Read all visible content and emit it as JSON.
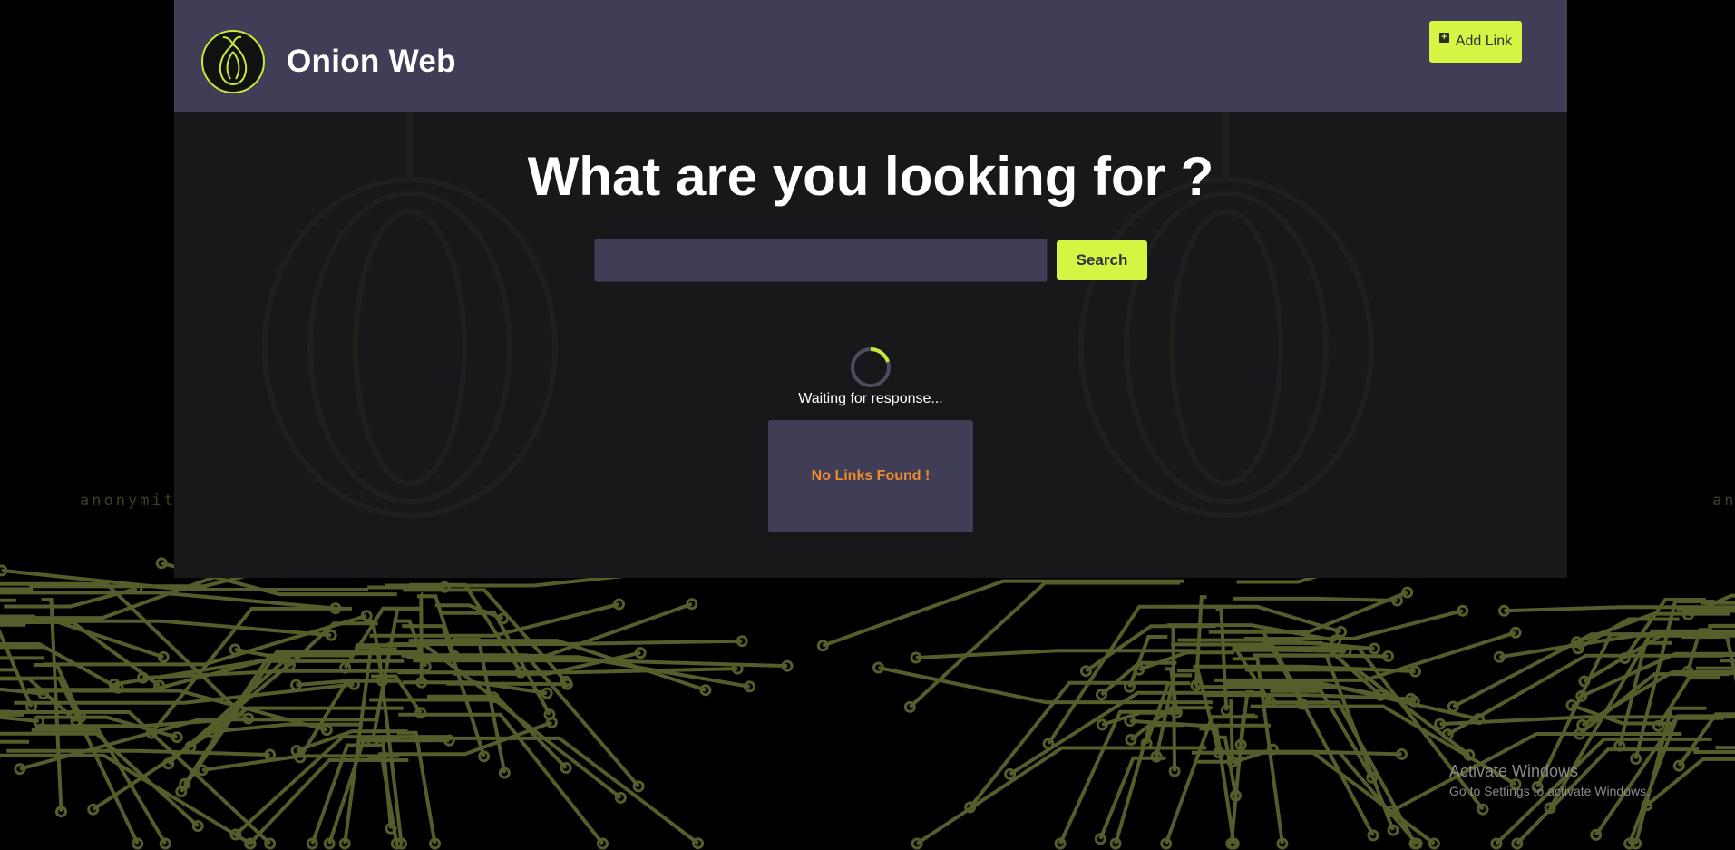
{
  "brand": {
    "name": "Onion Web",
    "logo_icon": "onion-logo-icon"
  },
  "header": {
    "add_link_label": "Add Link",
    "add_link_icon": "plus-square-icon"
  },
  "hero": {
    "headline": "What are you looking for ?"
  },
  "search": {
    "value": "",
    "placeholder": "",
    "button_label": "Search"
  },
  "status": {
    "waiting_text": "Waiting for response..."
  },
  "results": {
    "empty_message": "No Links Found !"
  },
  "background": {
    "text_fragment_left": "anonymit",
    "text_fragment_right": "ano"
  },
  "os_overlay": {
    "title": "Activate Windows",
    "subtitle": "Go to Settings to activate Windows."
  },
  "colors": {
    "accent": "#d4f542",
    "header_bg": "#403d56",
    "panel_bg": "#18181b",
    "warning": "#f08a2c",
    "circuit": "#565c2a"
  }
}
